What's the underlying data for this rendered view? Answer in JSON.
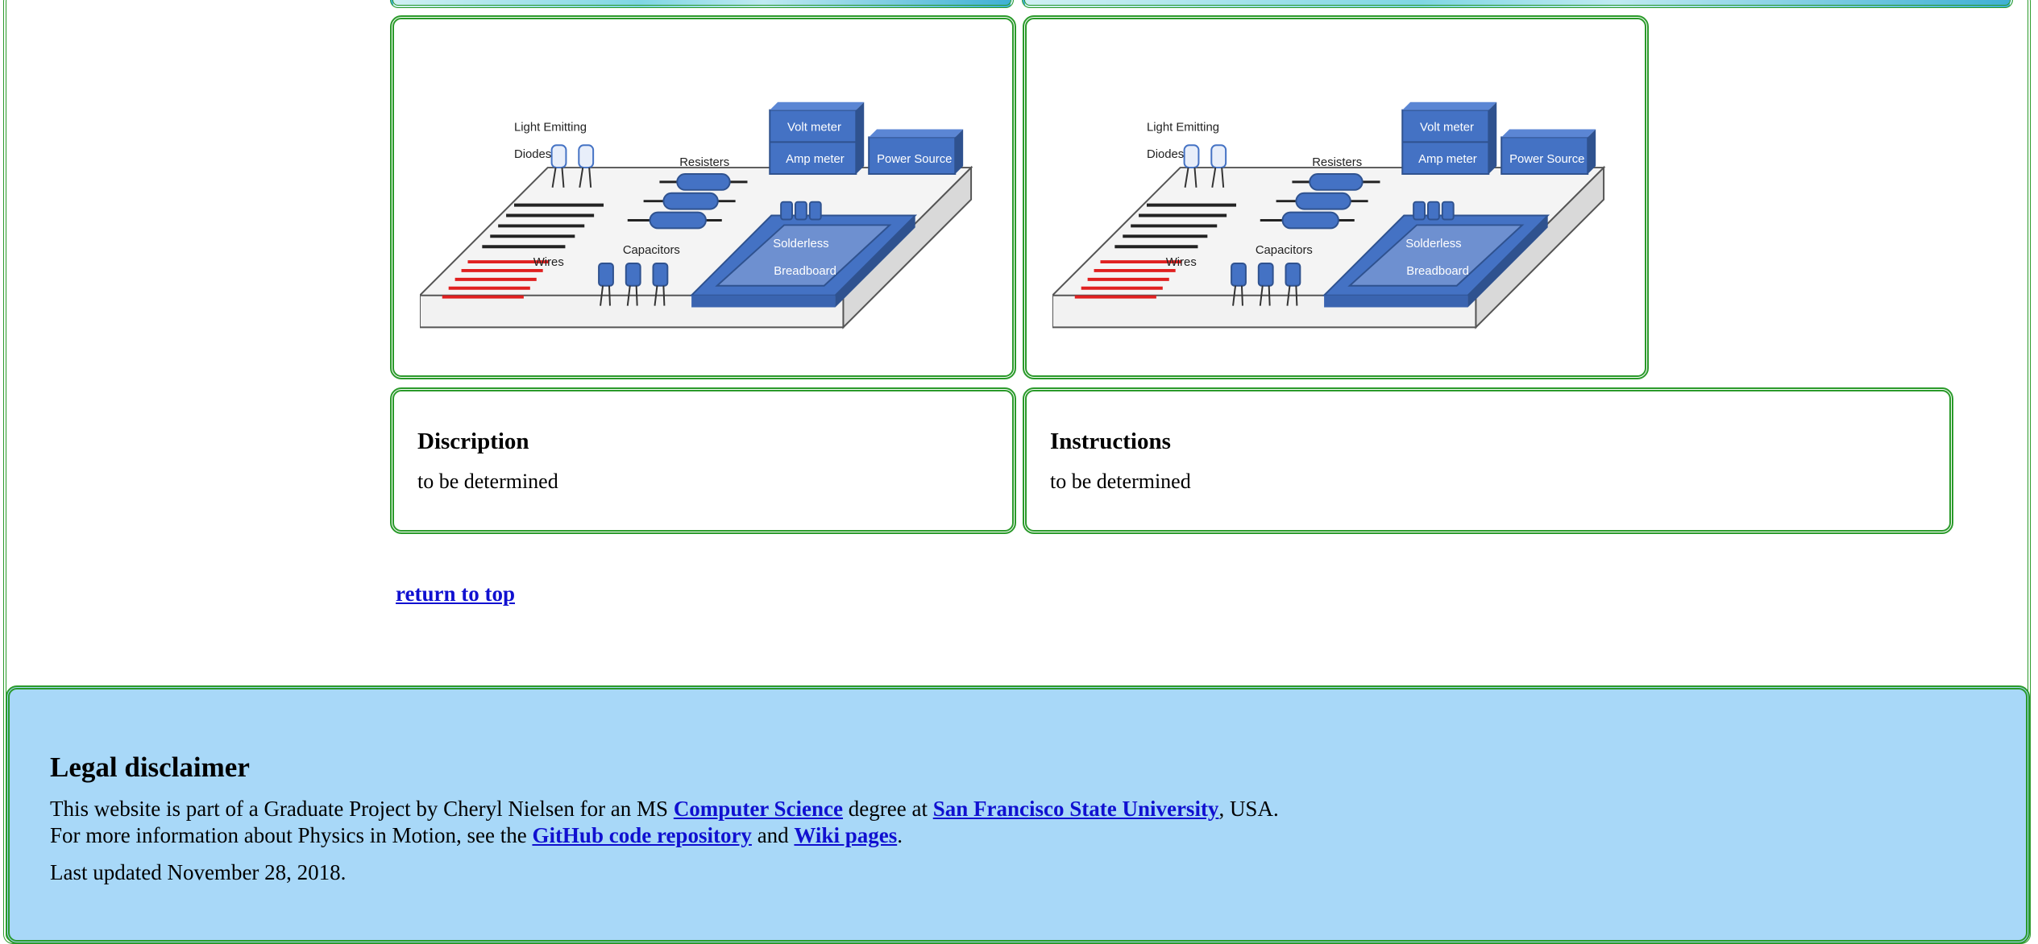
{
  "circuit": {
    "led_label_1": "Light Emitting",
    "led_label_2": "Diodes",
    "resisters": "Resisters",
    "capacitors": "Capacitors",
    "wires": "Wires",
    "volt_meter": "Volt meter",
    "amp_meter": "Amp meter",
    "power_source": "Power Source",
    "breadboard_1": "Solderless",
    "breadboard_2": "Breadboard"
  },
  "description": {
    "title": "Discription",
    "body": "to be determined"
  },
  "instructions": {
    "title": "Instructions",
    "body": "to be determined"
  },
  "return_link": "return to top",
  "footer": {
    "title": "Legal disclaimer",
    "line1_pre": "This website is part of a Graduate Project by Cheryl Nielsen for an MS ",
    "link_cs": "Computer Science",
    "line1_mid": " degree at ",
    "link_sfsu": "San Francisco State University",
    "line1_post": ", USA.",
    "line2_pre": "For more information about Physics in Motion, see the ",
    "link_github": "GitHub code repository",
    "line2_mid": " and ",
    "link_wiki": "Wiki pages",
    "line2_post": ".",
    "updated": "Last updated November 28, 2018."
  },
  "colors": {
    "frame_green": "#2a9a2a",
    "footer_bg": "#a8d8f8",
    "link_blue": "#1010d0",
    "component_blue": "#4472c4"
  }
}
